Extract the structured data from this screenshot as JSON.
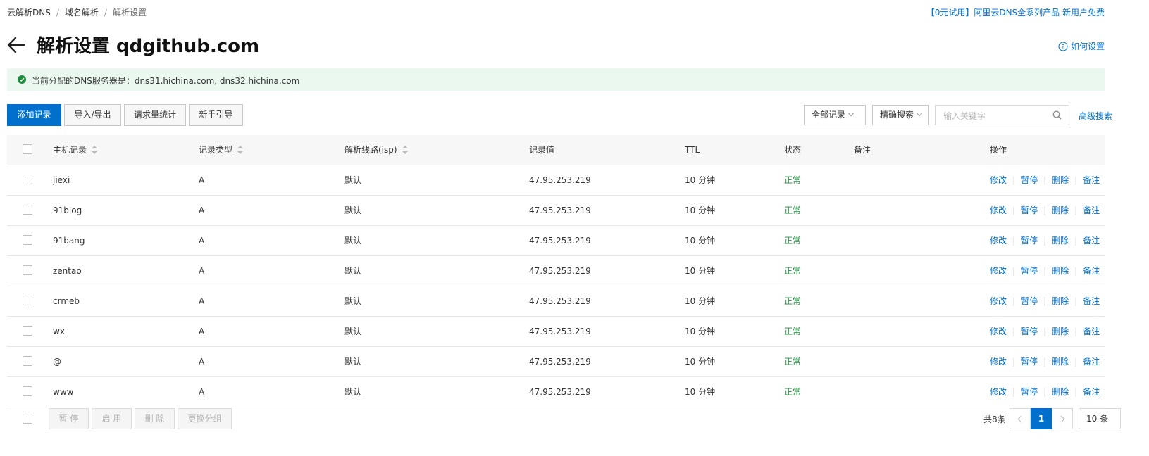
{
  "breadcrumb": [
    "云解析DNS",
    "域名解析",
    "解析设置"
  ],
  "promo_text": "【0元试用】阿里云DNS全系列产品 新用户免费",
  "page_title": "解析设置 qdgithub.com",
  "help_link": "如何设置",
  "notice": "当前分配的DNS服务器是：dns31.hichina.com, dns32.hichina.com",
  "toolbar": {
    "add_record": "添加记录",
    "import_export": "导入/导出",
    "request_stats": "请求量统计",
    "beginner_guide": "新手引导",
    "filter_select": "全部记录",
    "match_select": "精确搜索",
    "search_placeholder": "输入关键字",
    "advanced_search": "高级搜索"
  },
  "table": {
    "headers": {
      "host": "主机记录",
      "type": "记录类型",
      "line": "解析线路(isp)",
      "value": "记录值",
      "ttl": "TTL",
      "status": "状态",
      "remark": "备注",
      "ops": "操作"
    },
    "actions": {
      "edit": "修改",
      "pause": "暂停",
      "delete": "删除",
      "remark": "备注"
    },
    "rows": [
      {
        "host": "jiexi",
        "type": "A",
        "line": "默认",
        "value": "47.95.253.219",
        "ttl": "10 分钟",
        "status": "正常",
        "remark": ""
      },
      {
        "host": "91blog",
        "type": "A",
        "line": "默认",
        "value": "47.95.253.219",
        "ttl": "10 分钟",
        "status": "正常",
        "remark": ""
      },
      {
        "host": "91bang",
        "type": "A",
        "line": "默认",
        "value": "47.95.253.219",
        "ttl": "10 分钟",
        "status": "正常",
        "remark": ""
      },
      {
        "host": "zentao",
        "type": "A",
        "line": "默认",
        "value": "47.95.253.219",
        "ttl": "10 分钟",
        "status": "正常",
        "remark": ""
      },
      {
        "host": "crmeb",
        "type": "A",
        "line": "默认",
        "value": "47.95.253.219",
        "ttl": "10 分钟",
        "status": "正常",
        "remark": ""
      },
      {
        "host": "wx",
        "type": "A",
        "line": "默认",
        "value": "47.95.253.219",
        "ttl": "10 分钟",
        "status": "正常",
        "remark": ""
      },
      {
        "host": "@",
        "type": "A",
        "line": "默认",
        "value": "47.95.253.219",
        "ttl": "10 分钟",
        "status": "正常",
        "remark": ""
      },
      {
        "host": "www",
        "type": "A",
        "line": "默认",
        "value": "47.95.253.219",
        "ttl": "10 分钟",
        "status": "正常",
        "remark": ""
      }
    ]
  },
  "footer": {
    "pause": "暂 停",
    "enable": "启 用",
    "delete": "删 除",
    "change_group": "更换分组",
    "total": "共8条",
    "current_page": "1",
    "page_size": "10 条"
  },
  "colors": {
    "primary": "#0070cc",
    "status_ok": "#1e8e3e",
    "notice_bg": "#ebf8f0"
  },
  "icons": [
    "back-arrow-icon",
    "help-circle-icon",
    "check-circle-icon",
    "search-icon",
    "chevron-down-icon",
    "sort-icon"
  ]
}
